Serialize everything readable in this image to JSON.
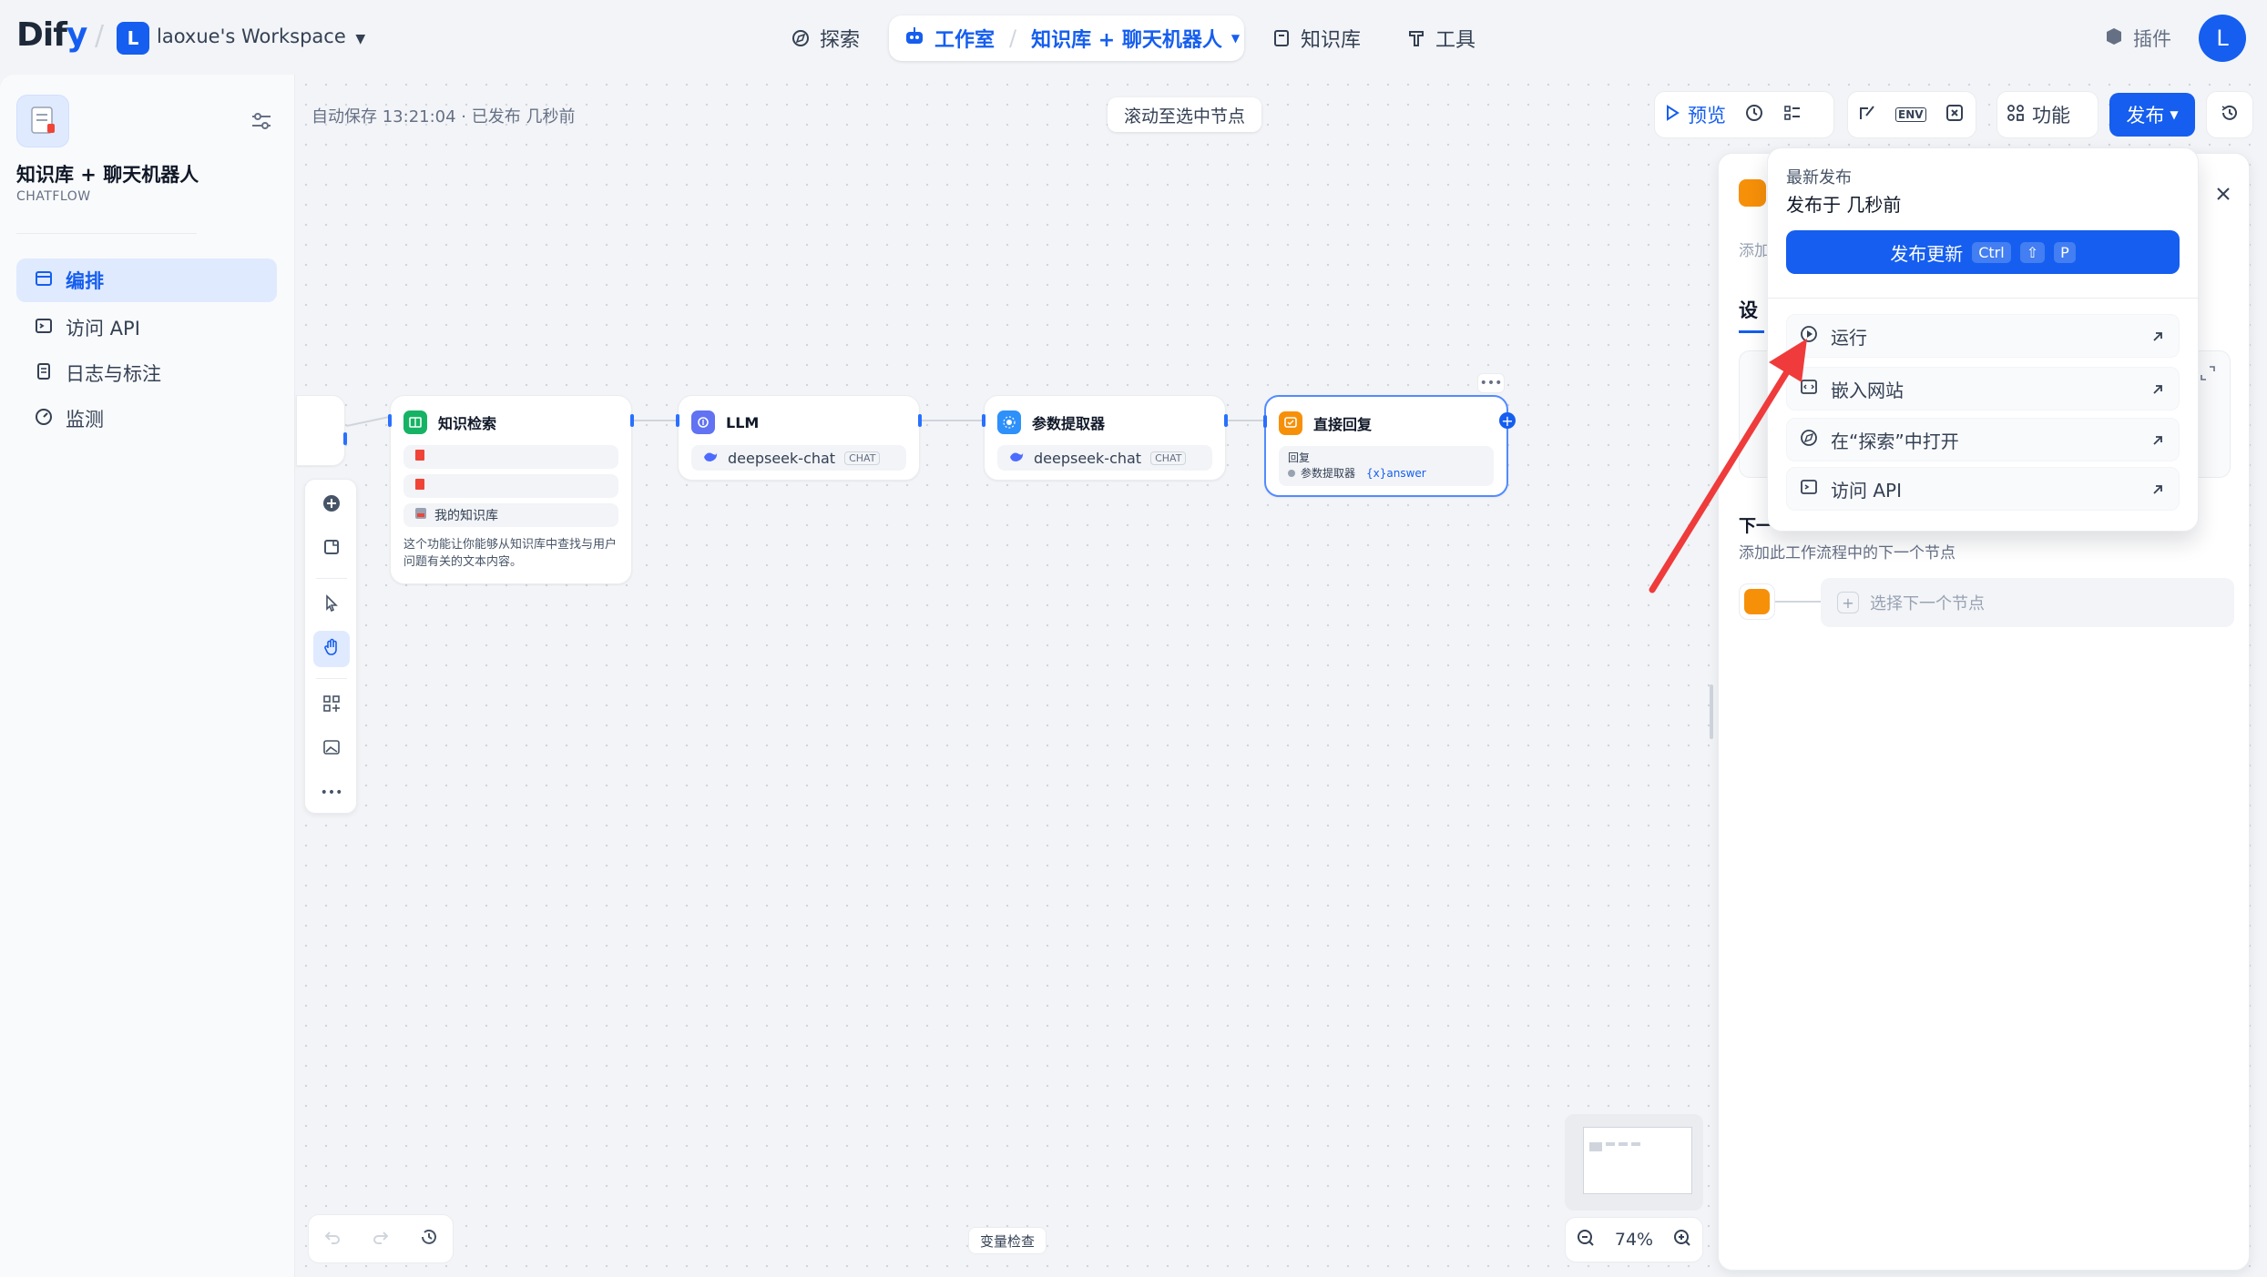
{
  "header": {
    "logo": {
      "part1": "Di",
      "part2": "f",
      "part3": "y"
    },
    "workspace_initial": "L",
    "workspace_name": "laoxue's Workspace",
    "nav": {
      "explore": "探索",
      "studio": "工作室",
      "app": "知识库 + 聊天机器人",
      "knowledge": "知识库",
      "tools": "工具"
    },
    "plugin": "插件",
    "user_initial": "L"
  },
  "sidebar": {
    "app_title": "知识库 + 聊天机器人",
    "app_type": "CHATFLOW",
    "items": [
      {
        "label": "编排"
      },
      {
        "label": "访问 API"
      },
      {
        "label": "日志与标注"
      },
      {
        "label": "监测"
      }
    ]
  },
  "canvas": {
    "autosave": "自动保存 13:21:04 · 已发布 几秒前",
    "scroll_to_node": "滚动至选中节点",
    "variable_check": "变量检查",
    "zoom": "74%"
  },
  "toolbar": {
    "preview": "预览",
    "features": "功能",
    "publish": "发布",
    "env_label": "ENV"
  },
  "nodes": {
    "knowledge_retrieval": {
      "title": "知识检索",
      "kb_name": "我的知识库",
      "desc": "这个功能让你能够从知识库中查找与用户问题有关的文本内容。"
    },
    "llm": {
      "title": "LLM",
      "model": "deepseek-chat",
      "tag": "CHAT"
    },
    "param_extractor": {
      "title": "参数提取器",
      "model": "deepseek-chat",
      "tag": "CHAT"
    },
    "direct_reply": {
      "title": "直接回复",
      "label": "回复",
      "var_source": "参数提取器",
      "var_name": "{x}answer"
    }
  },
  "right_panel": {
    "add_desc": "添加",
    "tab": "设",
    "next_title": "下一",
    "next_desc": "添加此工作流程中的下一个节点",
    "select_next": "选择下一个节点"
  },
  "publish_dropdown": {
    "latest": "最新发布",
    "published_at": "发布于 几秒前",
    "publish_update": "发布更新",
    "shortcut": [
      "Ctrl",
      "⇧",
      "P"
    ],
    "items": [
      {
        "label": "运行"
      },
      {
        "label": "嵌入网站"
      },
      {
        "label": "在“探索”中打开"
      },
      {
        "label": "访问 API"
      }
    ]
  },
  "colors": {
    "primary": "#155eef",
    "knowledge_node": "#16b364",
    "llm_node": "#6172f3",
    "param_node": "#2e90fa",
    "reply_node": "#f79009",
    "annotation_arrow": "#ef3b3b"
  }
}
